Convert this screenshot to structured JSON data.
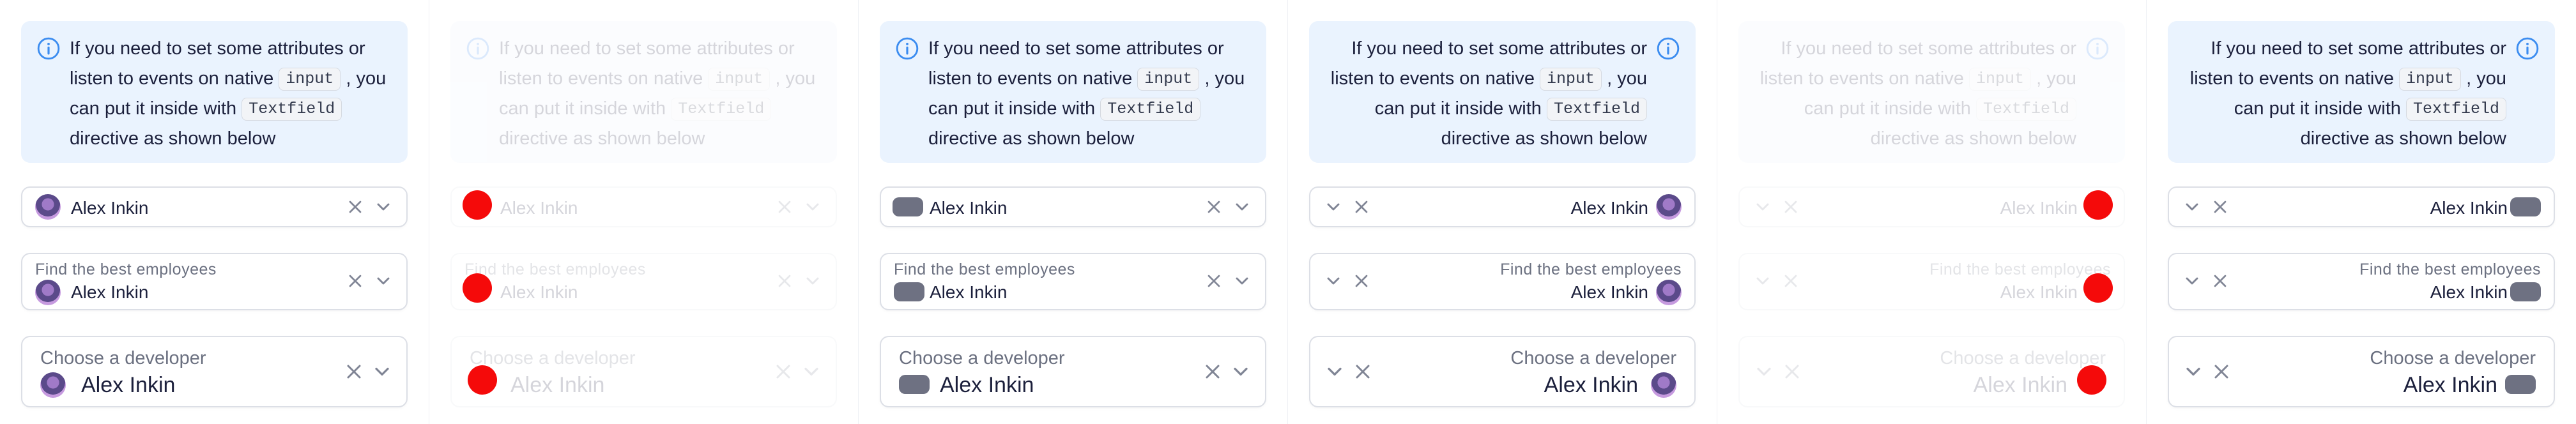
{
  "notification": {
    "line1": "If you need to set some attributes or",
    "line2_pre": "listen to events on native",
    "code1": "input",
    "line2_post": ", you",
    "line3_pre": "can put it inside with",
    "code2": "Textfield",
    "line4": "directive as shown below"
  },
  "fields": {
    "small": {
      "value": "Alex Inkin"
    },
    "medium": {
      "label": "Find the best employees",
      "value": "Alex Inkin"
    },
    "large": {
      "label": "Choose a developer",
      "value": "Alex Inkin"
    }
  },
  "icons": {
    "info": "info-icon",
    "clear": "close-icon",
    "expand": "chevron-down-icon"
  },
  "colors": {
    "notification_bg": "#eaf3fe",
    "info_icon": "#3b8cf0",
    "red_dot": "#f50a0a",
    "pill": "#6e7182"
  }
}
